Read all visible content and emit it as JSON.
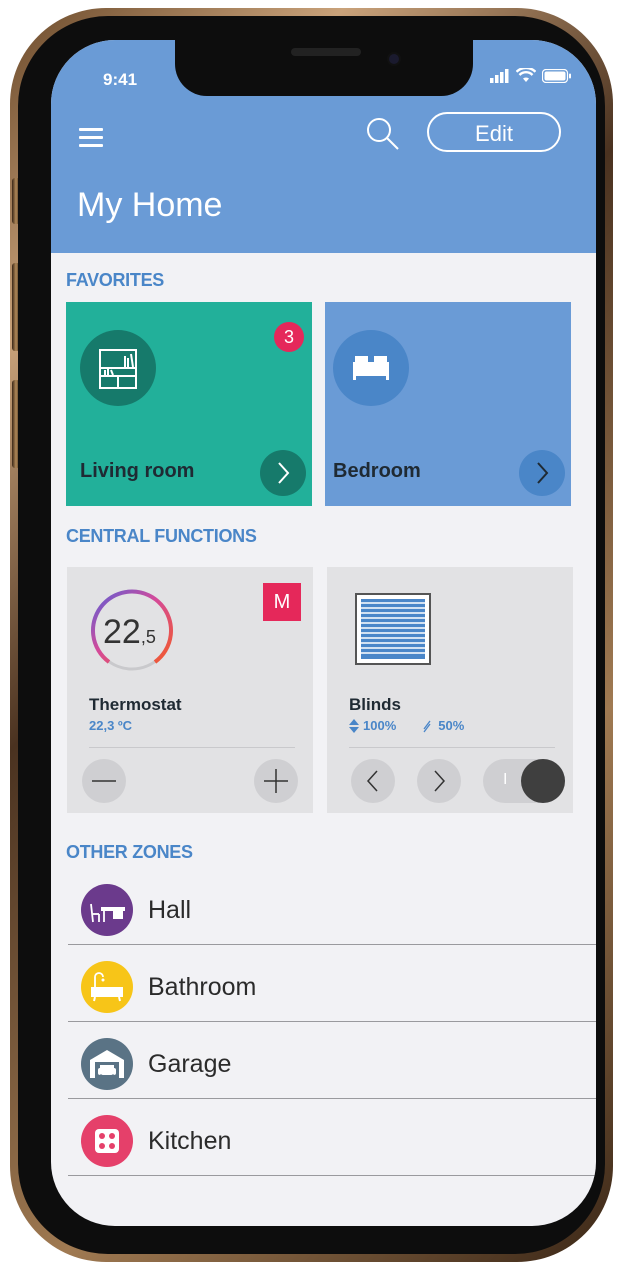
{
  "status_bar": {
    "time": "9:41"
  },
  "header": {
    "title": "My Home",
    "edit_label": "Edit"
  },
  "favorites": {
    "section_title": "FAVORITES",
    "items": [
      {
        "name": "Living room",
        "badge": "3",
        "color": "#22b09a"
      },
      {
        "name": "Bedroom",
        "color": "#6a9bd6"
      }
    ]
  },
  "central_functions": {
    "section_title": "CENTRAL FUNCTIONS",
    "thermostat": {
      "value_main": "22",
      "value_decimal": ",5",
      "mode_badge": "M",
      "title": "Thermostat",
      "current": "22,3 ºC"
    },
    "blinds": {
      "title": "Blinds",
      "position": "100%",
      "tilt": "50%",
      "toggle_glyph": "I"
    }
  },
  "other_zones": {
    "section_title": "OTHER ZONES",
    "items": [
      {
        "name": "Hall",
        "icon": "hall-icon",
        "color": "#6b3a8c"
      },
      {
        "name": "Bathroom",
        "icon": "bathtub-icon",
        "color": "#f7c518"
      },
      {
        "name": "Garage",
        "icon": "garage-icon",
        "color": "#5a7385"
      },
      {
        "name": "Kitchen",
        "icon": "kitchen-icon",
        "color": "#e5406a"
      }
    ]
  },
  "colors": {
    "header": "#6a9bd6",
    "accent": "#4a86c8",
    "badge": "#e5285a"
  }
}
